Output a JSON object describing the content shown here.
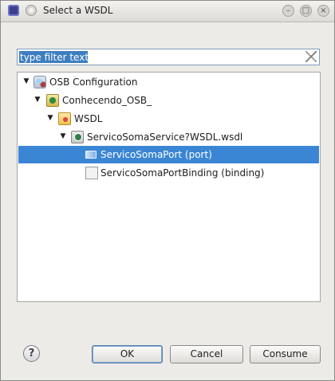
{
  "window": {
    "title": "Select a WSDL"
  },
  "filter": {
    "value": "type filter text"
  },
  "tree": {
    "nodes": [
      {
        "label": "OSB Configuration",
        "icon": "osb-configuration-icon"
      },
      {
        "label": "Conhecendo_OSB_",
        "icon": "project-icon"
      },
      {
        "label": "WSDL",
        "icon": "folder-icon"
      },
      {
        "label": "ServicoSomaService?WSDL.wsdl",
        "icon": "wsdl-file-icon"
      },
      {
        "label": "ServicoSomaPort (port)",
        "icon": "port-icon",
        "selected": true
      },
      {
        "label": "ServicoSomaPortBinding (binding)",
        "icon": "binding-icon"
      }
    ]
  },
  "buttons": {
    "ok": "OK",
    "cancel": "Cancel",
    "consume": "Consume",
    "help": "?"
  },
  "colors": {
    "selection": "#3b86d4",
    "focus_border": "#7aa7d9"
  }
}
